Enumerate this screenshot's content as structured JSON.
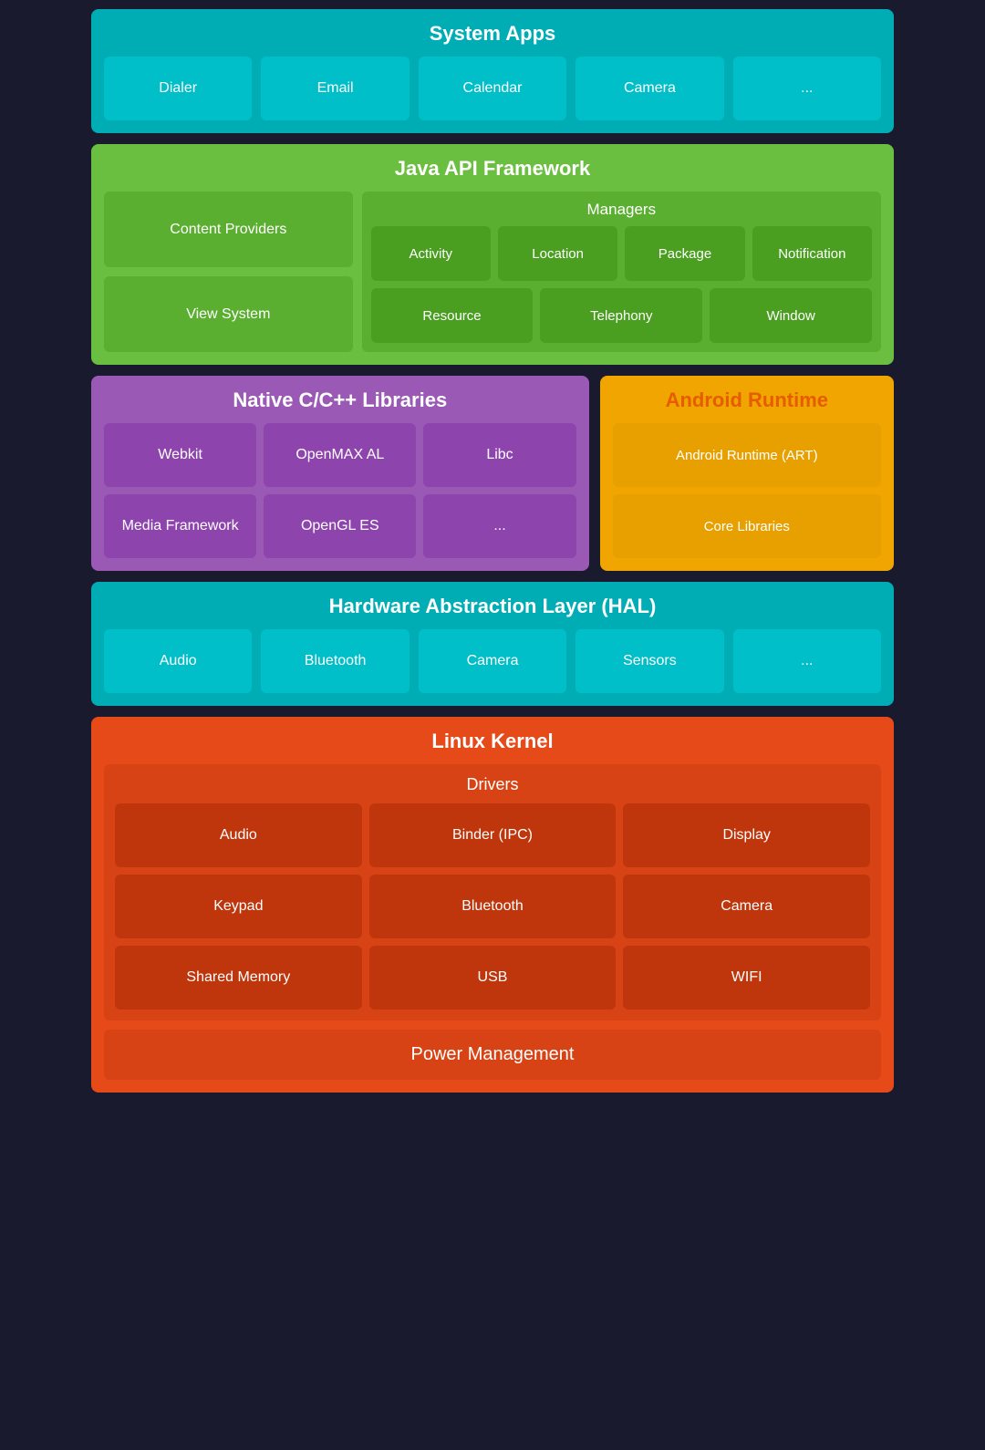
{
  "systemApps": {
    "title": "System Apps",
    "items": [
      "Dialer",
      "Email",
      "Calendar",
      "Camera",
      "..."
    ]
  },
  "javaApi": {
    "title": "Java API Framework",
    "leftItems": [
      "Content Providers",
      "View System"
    ],
    "managers": {
      "title": "Managers",
      "row1": [
        "Activity",
        "Location",
        "Package",
        "Notification"
      ],
      "row2": [
        "Resource",
        "Telephony",
        "Window"
      ]
    }
  },
  "nativeCpp": {
    "title": "Native C/C++ Libraries",
    "row1": [
      "Webkit",
      "OpenMAX AL",
      "Libc"
    ],
    "row2": [
      "Media Framework",
      "OpenGL ES",
      "..."
    ]
  },
  "androidRuntime": {
    "title": "Android Runtime",
    "items": [
      "Android Runtime (ART)",
      "Core Libraries"
    ]
  },
  "hal": {
    "title": "Hardware Abstraction Layer (HAL)",
    "items": [
      "Audio",
      "Bluetooth",
      "Camera",
      "Sensors",
      "..."
    ]
  },
  "linuxKernel": {
    "title": "Linux Kernel",
    "drivers": {
      "title": "Drivers",
      "row1": [
        "Audio",
        "Binder (IPC)",
        "Display"
      ],
      "row2": [
        "Keypad",
        "Bluetooth",
        "Camera"
      ],
      "row3": [
        "Shared Memory",
        "USB",
        "WIFI"
      ]
    },
    "powerManagement": "Power Management"
  }
}
